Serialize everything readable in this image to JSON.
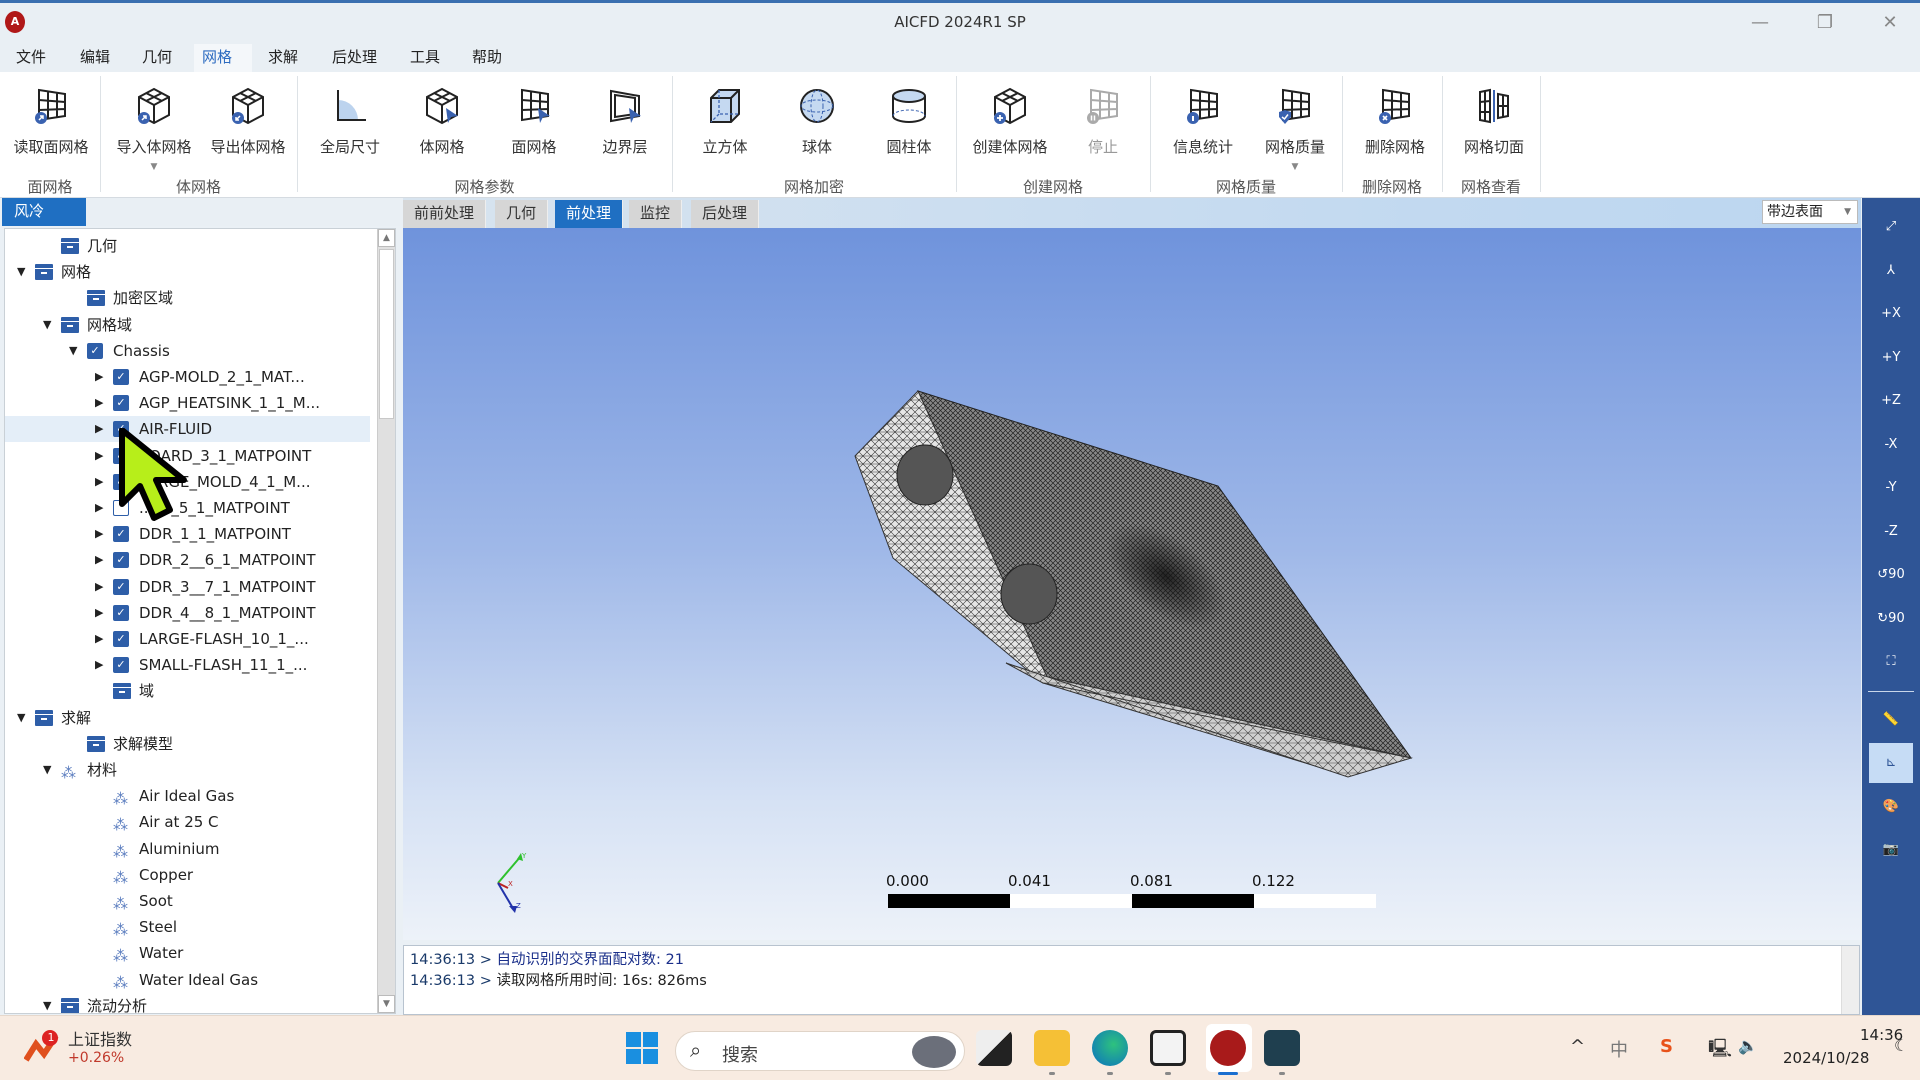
{
  "window": {
    "title": "AICFD 2024R1 SP",
    "logo": "A",
    "minimize": "—",
    "restore": "❐",
    "close": "✕"
  },
  "menu": [
    "文件",
    "编辑",
    "几何",
    "网格",
    "求解",
    "后处理",
    "工具",
    "帮助"
  ],
  "menu_active": "网格",
  "ribbon": {
    "buttons": [
      {
        "label": "读取面网格",
        "icon": "read-surface-mesh-icon"
      },
      {
        "label": "导入体网格",
        "icon": "import-volume-mesh-icon",
        "dropdown": true
      },
      {
        "label": "导出体网格",
        "icon": "export-volume-mesh-icon"
      },
      {
        "label": "全局尺寸",
        "icon": "global-size-icon"
      },
      {
        "label": "体网格",
        "icon": "volume-mesh-icon"
      },
      {
        "label": "面网格",
        "icon": "surface-mesh-icon"
      },
      {
        "label": "边界层",
        "icon": "boundary-layer-icon"
      },
      {
        "label": "立方体",
        "icon": "cube-icon"
      },
      {
        "label": "球体",
        "icon": "sphere-icon"
      },
      {
        "label": "圆柱体",
        "icon": "cylinder-icon"
      },
      {
        "label": "创建体网格",
        "icon": "create-volume-mesh-icon"
      },
      {
        "label": "停止",
        "icon": "stop-icon",
        "disabled": true
      },
      {
        "label": "信息统计",
        "icon": "info-statistics-icon"
      },
      {
        "label": "网格质量",
        "icon": "mesh-quality-icon",
        "dropdown": true
      },
      {
        "label": "删除网格",
        "icon": "delete-mesh-icon"
      },
      {
        "label": "网格切面",
        "icon": "mesh-slice-icon"
      }
    ],
    "groups": [
      "面网格",
      "体网格",
      "网格参数",
      "网格加密",
      "创建网格",
      "网格质量",
      "删除网格",
      "网格查看"
    ]
  },
  "left_panel": {
    "tab": "风冷",
    "tree": [
      {
        "label": "几何",
        "type": "folder",
        "level": 1,
        "expander": ""
      },
      {
        "label": "网格",
        "type": "folder",
        "level": 0,
        "expander": "▼"
      },
      {
        "label": "加密区域",
        "type": "folder",
        "level": 2,
        "expander": ""
      },
      {
        "label": "网格域",
        "type": "folder",
        "level": 1,
        "expander": "▼"
      },
      {
        "label": "Chassis",
        "type": "check",
        "checked": true,
        "level": 2,
        "expander": "▼"
      },
      {
        "label": "AGP-MOLD_2_1_MAT...",
        "type": "check",
        "checked": true,
        "level": 3,
        "expander": "▶"
      },
      {
        "label": "AGP_HEATSINK_1_1_M...",
        "type": "check",
        "checked": true,
        "level": 3,
        "expander": "▶"
      },
      {
        "label": "AIR-FLUID",
        "type": "check",
        "checked": true,
        "level": 3,
        "expander": "▶",
        "selected": true
      },
      {
        "label": "BOARD_3_1_MATPOINT",
        "type": "check",
        "checked": true,
        "level": 3,
        "expander": "▶"
      },
      {
        "label": "LARGE_MOLD_4_1_M...",
        "type": "check",
        "checked": true,
        "level": 3,
        "expander": "▶"
      },
      {
        "label": "..NG_5_1_MATPOINT",
        "type": "check",
        "checked": false,
        "level": 3,
        "expander": "▶"
      },
      {
        "label": "DDR_1_1_MATPOINT",
        "type": "check",
        "checked": true,
        "level": 3,
        "expander": "▶"
      },
      {
        "label": "DDR_2__6_1_MATPOINT",
        "type": "check",
        "checked": true,
        "level": 3,
        "expander": "▶"
      },
      {
        "label": "DDR_3__7_1_MATPOINT",
        "type": "check",
        "checked": true,
        "level": 3,
        "expander": "▶"
      },
      {
        "label": "DDR_4__8_1_MATPOINT",
        "type": "check",
        "checked": true,
        "level": 3,
        "expander": "▶"
      },
      {
        "label": "LARGE-FLASH_10_1_...",
        "type": "check",
        "checked": true,
        "level": 3,
        "expander": "▶"
      },
      {
        "label": "SMALL-FLASH_11_1_...",
        "type": "check",
        "checked": true,
        "level": 3,
        "expander": "▶"
      },
      {
        "label": "域",
        "type": "folder",
        "level": 3,
        "expander": ""
      },
      {
        "label": "求解",
        "type": "folder",
        "level": 0,
        "expander": "▼"
      },
      {
        "label": "求解模型",
        "type": "folder",
        "level": 2,
        "expander": ""
      },
      {
        "label": "材料",
        "type": "material",
        "level": 1,
        "expander": "▼"
      },
      {
        "label": "Air Ideal Gas",
        "type": "material",
        "level": 3,
        "expander": ""
      },
      {
        "label": "Air at 25 C",
        "type": "material",
        "level": 3,
        "expander": ""
      },
      {
        "label": "Aluminium",
        "type": "material",
        "level": 3,
        "expander": ""
      },
      {
        "label": "Copper",
        "type": "material",
        "level": 3,
        "expander": ""
      },
      {
        "label": "Soot",
        "type": "material",
        "level": 3,
        "expander": ""
      },
      {
        "label": "Steel",
        "type": "material",
        "level": 3,
        "expander": ""
      },
      {
        "label": "Water",
        "type": "material",
        "level": 3,
        "expander": ""
      },
      {
        "label": "Water Ideal Gas",
        "type": "material",
        "level": 3,
        "expander": ""
      },
      {
        "label": "流动分析",
        "type": "folder",
        "level": 1,
        "expander": "▼"
      }
    ]
  },
  "view_tabs": [
    "前前处理",
    "几何",
    "前处理",
    "监控",
    "后处理"
  ],
  "view_tab_active": "前处理",
  "display_mode": "带边表面",
  "viewport": {
    "scale_labels": [
      "0.000",
      "0.041",
      "0.081",
      "0.122"
    ],
    "axes": [
      "Y",
      "X",
      "Z"
    ]
  },
  "right_toolbar": [
    {
      "name": "fit-view-icon",
      "glyph": "⤢"
    },
    {
      "name": "isometric-view-icon",
      "glyph": "⅄"
    },
    {
      "name": "view-plus-x-icon",
      "glyph": "+X"
    },
    {
      "name": "view-plus-y-icon",
      "glyph": "+Y"
    },
    {
      "name": "view-plus-z-icon",
      "glyph": "+Z"
    },
    {
      "name": "view-minus-x-icon",
      "glyph": "-X"
    },
    {
      "name": "view-minus-y-icon",
      "glyph": "-Y"
    },
    {
      "name": "view-minus-z-icon",
      "glyph": "-Z"
    },
    {
      "name": "rotate-ccw-90-icon",
      "glyph": "↺90"
    },
    {
      "name": "rotate-cw-90-icon",
      "glyph": "↻90"
    },
    {
      "name": "fullscreen-icon",
      "glyph": "⛶"
    },
    {
      "name": "ruler-icon",
      "glyph": "📏"
    },
    {
      "name": "axes-toggle-icon",
      "glyph": "⊾",
      "active": true
    },
    {
      "name": "palette-icon",
      "glyph": "🎨"
    },
    {
      "name": "screenshot-icon",
      "glyph": "📷"
    }
  ],
  "log": [
    {
      "time": "14:36:13 >",
      "msg": " 自动识别的交界面配对数: 21"
    },
    {
      "time": "14:36:13 >",
      "msg": " 读取网格所用时间: 16s: 826ms"
    }
  ],
  "taskbar": {
    "stock_name": "上证指数",
    "stock_change": "+0.26%",
    "stock_badge": "1",
    "search_placeholder": "搜索",
    "tray_ime": "中",
    "time": "14:36",
    "date": "2024/10/28"
  }
}
